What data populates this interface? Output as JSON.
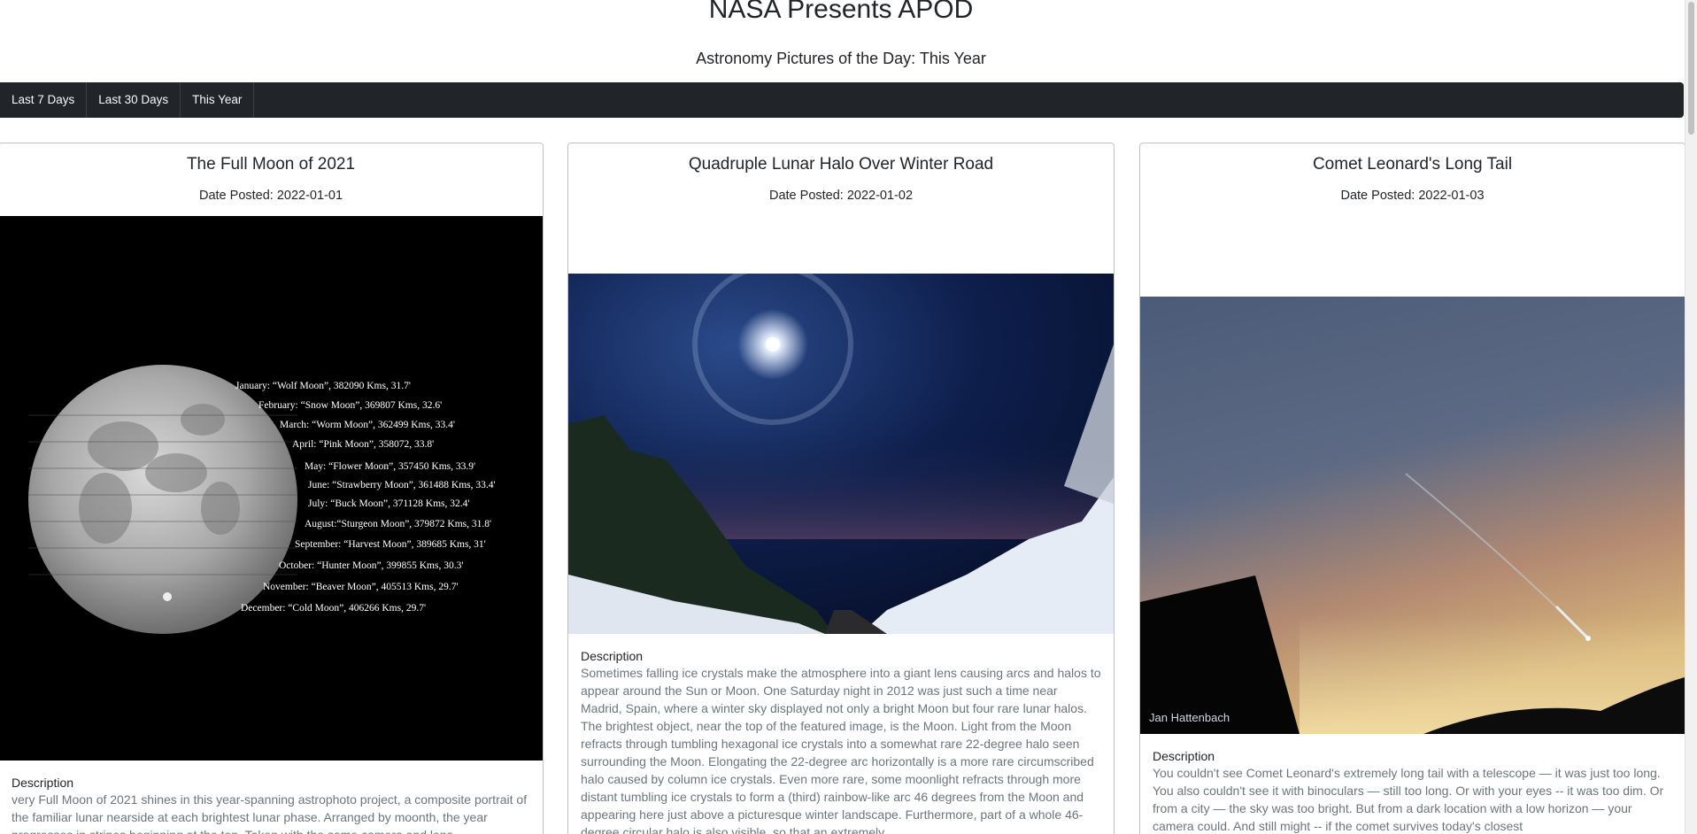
{
  "header": {
    "title": "NASA Presents APOD",
    "subtitle": "Astronomy Pictures of the Day: This Year"
  },
  "nav": {
    "items": [
      "Last 7 Days",
      "Last 30 Days",
      "This Year"
    ]
  },
  "cards": [
    {
      "title": "The Full Moon of 2021",
      "date": "Date Posted: 2022-01-01",
      "description_label": "Description",
      "description": "very Full Moon of 2021 shines in this year-spanning astrophoto project, a composite portrait of the familiar lunar nearside at each brightest lunar phase. Arranged by moonth, the year progresses in stripes beginning at the top. Taken with the same camera and lens",
      "image_labels": [
        "January: “Wolf Moon”, 382090 Kms, 31.7'",
        "February: “Snow Moon”, 369807 Kms, 32.6'",
        "March: “Worm Moon”, 362499 Kms, 33.4'",
        "April: “Pink Moon”, 358072, 33.8'",
        "May: “Flower Moon”, 357450 Kms, 33.9'",
        "June: “Strawberry Moon”, 361488 Kms, 33.4'",
        "July: “Buck Moon”, 371128 Kms, 32.4'",
        "August:“Sturgeon Moon”, 379872 Kms, 31.8'",
        "September: “Harvest Moon”, 389685 Kms, 31'",
        "October: “Hunter Moon”, 399855 Kms, 30.3'",
        "November: “Beaver Moon”, 405513 Kms, 29.7'",
        "December: “Cold Moon”, 406266 Kms, 29.7'"
      ]
    },
    {
      "title": "Quadruple Lunar Halo Over Winter Road",
      "date": "Date Posted: 2022-01-02",
      "description_label": "Description",
      "description": "Sometimes falling ice crystals make the atmosphere into a giant lens causing arcs and halos to appear around the Sun or Moon. One Saturday night in 2012 was just such a time near Madrid, Spain, where a winter sky displayed not only a bright Moon but four rare lunar halos. The brightest object, near the top of the featured image, is the Moon. Light from the Moon refracts through tumbling hexagonal ice crystals into a somewhat rare 22-degree halo seen surrounding the Moon. Elongating the 22-degree arc horizontally is a more rare circumscribed halo caused by column ice crystals. Even more rare, some moonlight refracts through more distant tumbling ice crystals to form a (third) rainbow-like arc 46 degrees from the Moon and appearing here just above a picturesque winter landscape. Furthermore, part of a whole 46-degree circular halo is also visible, so that an extremely"
    },
    {
      "title": "Comet Leonard's Long Tail",
      "date": "Date Posted: 2022-01-03",
      "description_label": "Description",
      "description": "You couldn't see Comet Leonard's extremely long tail with a telescope — it was just too long. You also couldn't see it with binoculars — still too long. Or with your eyes -- it was too dim. Or from a city — the sky was too bright. But from a dark location with a low horizon — your camera could. And still might -- if the comet survives today's closest",
      "image_credit": "Jan Hattenbach"
    }
  ]
}
